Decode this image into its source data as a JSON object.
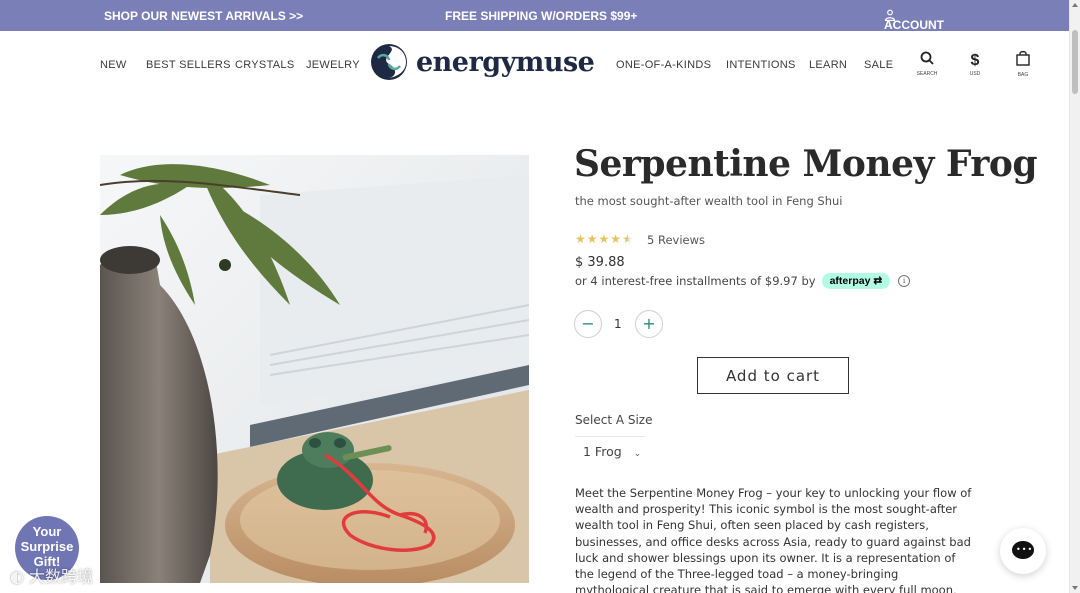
{
  "promo_bar": {
    "left": "SHOP OUR NEWEST ARRIVALS >>",
    "center": "FREE SHIPPING W/ORDERS $99+",
    "account": "ACCOUNT"
  },
  "nav": {
    "left_items": [
      "NEW",
      "BEST SELLERS",
      "CRYSTALS",
      "JEWELRY"
    ],
    "logo_text": "energymuse",
    "right_items": [
      "ONE-OF-A-KINDS",
      "INTENTIONS",
      "LEARN",
      "SALE"
    ],
    "icons": [
      {
        "icon": "search-icon",
        "caption": "SEARCH"
      },
      {
        "icon": "currency-icon",
        "glyph": "$",
        "caption": "USD"
      },
      {
        "icon": "bag-icon",
        "caption": "BAG"
      }
    ]
  },
  "product": {
    "title": "Serpentine Money Frog",
    "subtitle": "the most sought-after wealth tool in Feng Shui",
    "rating": 4.5,
    "reviews_label": "5 Reviews",
    "price": "$ 39.88",
    "installments_text": "or 4 interest-free installments of $9.97 by",
    "afterpay_label": "afterpay",
    "quantity": "1",
    "add_to_cart_label": "Add to cart",
    "size_label": "Select A Size",
    "size_value": "1 Frog",
    "description": "Meet the Serpentine Money Frog – your key to unlocking your flow of wealth and prosperity! This iconic symbol is the most sought-after wealth tool in Feng Shui, often seen placed by cash registers, businesses, and office desks across Asia, ready to guard against bad luck and shower blessings upon its owner. It is a representation of the legend of the Three-legged toad – a money-bringing mythological creature that is said to emerge with every full moon, ushering waves of wealth and good fortune to those who see it."
  },
  "overlays": {
    "surprise_line1": "Your",
    "surprise_line2": "Surprise",
    "surprise_line3": "Gift!",
    "watermark": "大数跨境"
  },
  "colors": {
    "promo_bar": "#7b7fb8",
    "star": "#e6c35c",
    "afterpay": "#b2fce4",
    "qty_button_accent": "#2a8a7a",
    "logo_navy": "#1e2a44",
    "surprise_badge": "#7075b3"
  }
}
